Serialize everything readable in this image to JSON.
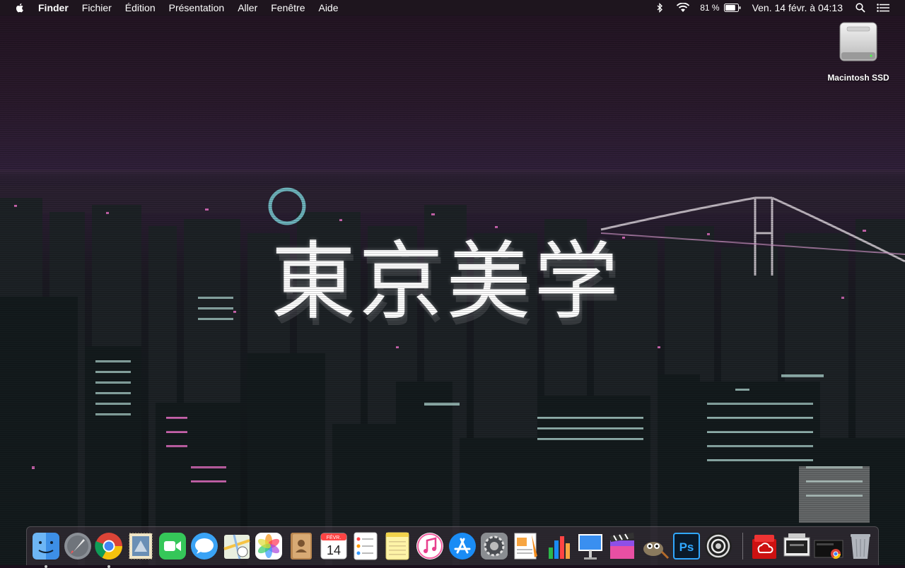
{
  "menubar": {
    "apple_icon": "apple-logo-icon",
    "app_name": "Finder",
    "items": [
      "Fichier",
      "Édition",
      "Présentation",
      "Aller",
      "Fenêtre",
      "Aide"
    ],
    "status": {
      "bluetooth_icon": "bluetooth-icon",
      "wifi_icon": "wifi-icon",
      "battery_percent": "81 %",
      "battery_level": 0.81,
      "clock": "Ven. 14 févr. à  04:13",
      "spotlight_icon": "search-icon",
      "notification_icon": "list-icon"
    }
  },
  "desktop": {
    "wallpaper_text": "東京美学",
    "icons": [
      {
        "label": "Macintosh SSD",
        "icon": "hard-drive-icon"
      }
    ]
  },
  "dock": {
    "apps": [
      {
        "name": "Finder",
        "icon": "finder-icon",
        "running": true
      },
      {
        "name": "Launchpad",
        "icon": "rocket-icon",
        "running": false
      },
      {
        "name": "Google Chrome",
        "icon": "chrome-icon",
        "running": true
      },
      {
        "name": "Mail",
        "icon": "mail-stamp-icon",
        "running": false
      },
      {
        "name": "FaceTime",
        "icon": "facetime-icon",
        "running": false
      },
      {
        "name": "Messages",
        "icon": "messages-icon",
        "running": false
      },
      {
        "name": "Plans",
        "icon": "maps-icon",
        "running": false
      },
      {
        "name": "Photos",
        "icon": "photos-icon",
        "running": false
      },
      {
        "name": "Contacts",
        "icon": "contacts-icon",
        "running": false
      },
      {
        "name": "Calendrier",
        "icon": "calendar-icon",
        "running": false,
        "month": "FÉVR.",
        "day": "14"
      },
      {
        "name": "Rappels",
        "icon": "reminders-icon",
        "running": false
      },
      {
        "name": "Notes",
        "icon": "notes-icon",
        "running": false
      },
      {
        "name": "iTunes",
        "icon": "music-icon",
        "running": false
      },
      {
        "name": "App Store",
        "icon": "app-store-icon",
        "running": false
      },
      {
        "name": "Préférences Système",
        "icon": "gear-icon",
        "running": false
      },
      {
        "name": "Pages",
        "icon": "pages-icon",
        "running": false
      },
      {
        "name": "Numbers",
        "icon": "numbers-icon",
        "running": false
      },
      {
        "name": "Keynote",
        "icon": "keynote-icon",
        "running": false
      },
      {
        "name": "Final Cut Pro",
        "icon": "clapper-icon",
        "running": false
      },
      {
        "name": "GIMP",
        "icon": "gimp-icon",
        "running": false
      },
      {
        "name": "Photoshop",
        "icon": "photoshop-icon",
        "running": false,
        "badge": "Ps"
      },
      {
        "name": "Aperture",
        "icon": "lens-icon",
        "running": false
      }
    ],
    "docs": [
      {
        "name": "Creative Cloud",
        "icon": "creative-cloud-icon"
      },
      {
        "name": "Screenshot",
        "icon": "screenshot-icon"
      },
      {
        "name": "Chrome Folder",
        "icon": "chrome-folder-icon"
      },
      {
        "name": "Corbeille",
        "icon": "trash-icon"
      }
    ]
  }
}
